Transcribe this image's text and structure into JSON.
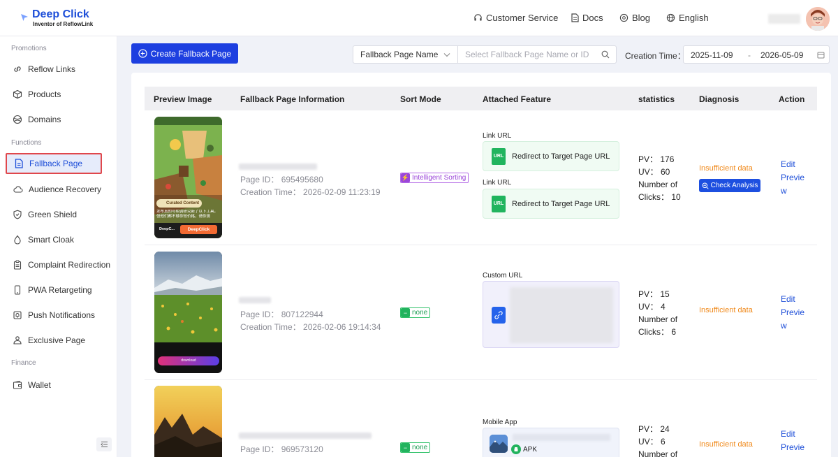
{
  "header": {
    "logo_title": "Deep Click",
    "logo_subtitle": "Inventor of ReflowLink",
    "nav": {
      "customer_service": "Customer Service",
      "docs": "Docs",
      "blog": "Blog",
      "language": "English"
    }
  },
  "sidebar": {
    "sections": {
      "promotions": "Promotions",
      "functions": "Functions",
      "finance": "Finance"
    },
    "items": [
      {
        "label": "Reflow Links",
        "icon": "link-icon"
      },
      {
        "label": "Products",
        "icon": "box-icon"
      },
      {
        "label": "Domains",
        "icon": "globe-icon"
      },
      {
        "label": "Fallback Page",
        "icon": "page-icon",
        "active": true
      },
      {
        "label": "Audience Recovery",
        "icon": "cloud-icon"
      },
      {
        "label": "Green Shield",
        "icon": "shield-icon"
      },
      {
        "label": "Smart Cloak",
        "icon": "drop-icon"
      },
      {
        "label": "Complaint Redirection",
        "icon": "clipboard-icon"
      },
      {
        "label": "PWA Retargeting",
        "icon": "phone-icon"
      },
      {
        "label": "Push Notifications",
        "icon": "bell-icon"
      },
      {
        "label": "Exclusive Page",
        "icon": "crown-icon"
      },
      {
        "label": "Wallet",
        "icon": "wallet-icon"
      }
    ]
  },
  "toolbar": {
    "create_label": "Create Fallback Page",
    "filter_select": "Fallback Page Name",
    "search_placeholder": "Select Fallback Page Name or ID",
    "creation_time_label": "Creation Time：",
    "date_start": "2025-11-09",
    "date_sep": "-",
    "date_end": "2026-05-09"
  },
  "table": {
    "headers": {
      "preview": "Preview Image",
      "info": "Fallback Page Information",
      "sort": "Sort Mode",
      "feature": "Attached Feature",
      "stats": "statistics",
      "diagnosis": "Diagnosis",
      "action": "Action"
    },
    "rows": [
      {
        "page_id": "Page ID：  695495680",
        "creation_time": "Creation Time：  2026-02-09 11:23:19",
        "sort_mode": "Intelligent Sorting",
        "feature_title_1": "Link URL",
        "feature_box_1": "Redirect to Target Page URL",
        "feature_title_2": "Link URL",
        "feature_box_2": "Redirect to Target Page URL",
        "pv": "PV：  176",
        "uv": "UV：  60",
        "clicks_line1": "Number of",
        "clicks_line2": "Clicks：  10",
        "diagnosis": "Insufficient data",
        "check_label": "Check Analysis",
        "edit": "Edit",
        "preview_1": "Previe",
        "preview_2": "w",
        "thumb_curated": "Curated Content",
        "thumb_text": "发布真的号相调研究新了以下工具，但他们都不够你较价格，请你测",
        "thumb_brand": "DeepC...",
        "thumb_cta": "DeepClick"
      },
      {
        "page_id": "Page ID：  807122944",
        "creation_time": "Creation Time：  2026-02-06 19:14:34",
        "sort_mode": "none",
        "feature_title_1": "Custom URL",
        "pv": "PV：  15",
        "uv": "UV：  4",
        "clicks_line1": "Number of",
        "clicks_line2": "Clicks：  6",
        "diagnosis": "Insufficient data",
        "edit": "Edit",
        "preview_1": "Previe",
        "preview_2": "w",
        "thumb_cta": "download"
      },
      {
        "page_id": "Page ID：  969573120",
        "sort_mode": "none",
        "feature_title_1": "Mobile App",
        "app_badge": "APK",
        "pv": "PV：  24",
        "uv": "UV：  6",
        "clicks_line1": "Number of",
        "diagnosis": "Insufficient data",
        "edit": "Edit",
        "preview_1": "Previe"
      }
    ]
  }
}
